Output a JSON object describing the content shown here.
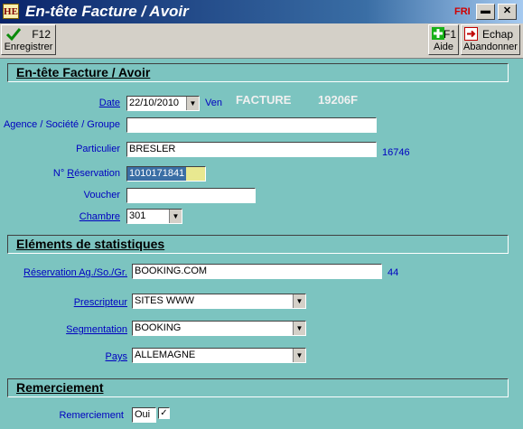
{
  "window": {
    "app_icon": "HE",
    "title": "En-tête Facture / Avoir",
    "lang": "FRI",
    "minimize_icon": "minimize-icon",
    "close_icon": "close-icon"
  },
  "toolbar": {
    "save": {
      "key": "F12",
      "label": "Enregistrer",
      "icon": "checkmark-icon"
    },
    "help": {
      "key": "F1",
      "label": "Aide",
      "icon": "plus-icon"
    },
    "cancel": {
      "key": "Echap",
      "label": "Abandonner",
      "icon": "exit-icon"
    }
  },
  "header_section": {
    "title": "En-tête Facture / Avoir",
    "date": {
      "label": "Date",
      "value": "22/10/2010",
      "weekday": "Ven"
    },
    "doc_type": "FACTURE",
    "doc_number": "19206F",
    "agency": {
      "label": "Agence / Société / Groupe",
      "value": ""
    },
    "individual": {
      "label": "Particulier",
      "value": "BRESLER",
      "code": "16746"
    },
    "reservation": {
      "label_prefix": "N° ",
      "label_u": "R",
      "label_rest": "éservation",
      "value": "1010171841"
    },
    "voucher": {
      "label": "Voucher",
      "value": ""
    },
    "room": {
      "label": "Chambre",
      "value": "301"
    }
  },
  "stats_section": {
    "title": "Eléments de statistiques",
    "reservation_source": {
      "label": "Réservation Ag./So./Gr.",
      "value": "BOOKING.COM",
      "code": "44"
    },
    "prescriber": {
      "label": "Prescripteur",
      "value": "SITES WWW"
    },
    "segmentation": {
      "label": "Segmentation",
      "value": "BOOKING"
    },
    "country": {
      "label": "Pays",
      "value": "ALLEMAGNE"
    }
  },
  "thanks_section": {
    "title": "Remerciement",
    "label": "Remerciement",
    "value": "Oui",
    "checked": true
  }
}
